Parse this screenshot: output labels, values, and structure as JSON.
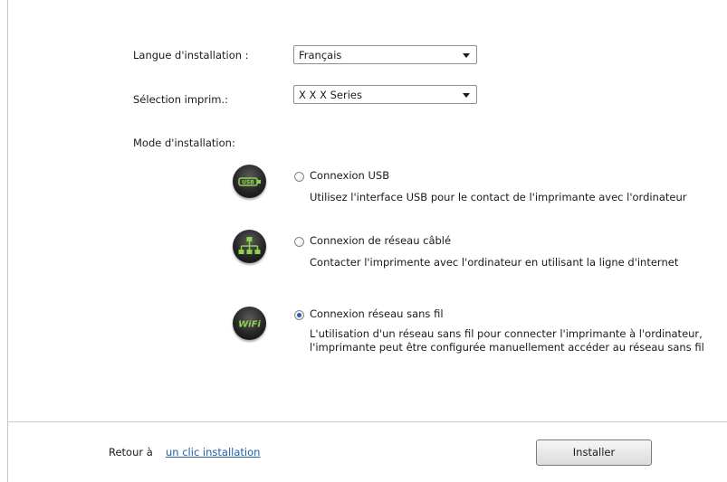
{
  "form": {
    "language_label": "Langue d'installation :",
    "language_value": "Français",
    "printer_label": "Sélection imprim.:",
    "printer_value": "X X X Series",
    "mode_label": "Mode d'installation:"
  },
  "options": [
    {
      "title": "Connexion USB",
      "description": "Utilisez  l'interface USB pour le contact de l'imprimante  avec l'ordinateur",
      "icon": "usb-icon",
      "icon_text": "USB",
      "selected": false
    },
    {
      "title": "Connexion de réseau câblé",
      "description": "Contacter l'imprimente avec l'ordinateur en utilisant la ligne d'internet",
      "icon": "wired-network-icon",
      "selected": false
    },
    {
      "title": "Connexion réseau sans fil",
      "description_line1": "L'utilisation d'un réseau sans fil pour connecter l'imprimante à l'ordinateur,",
      "description_line2": "l'imprimante peut être configurée manuellement accéder au réseau sans fil",
      "icon": "wifi-icon",
      "icon_text": "WiFi",
      "selected": true
    }
  ],
  "footer": {
    "back_prefix": "Retour à",
    "back_link": "un clic installation",
    "install_button": "Installer"
  },
  "colors": {
    "link": "#1f5ea8",
    "icon_accent": "#8fd14f",
    "radio_selected": "#2a5fb0"
  }
}
